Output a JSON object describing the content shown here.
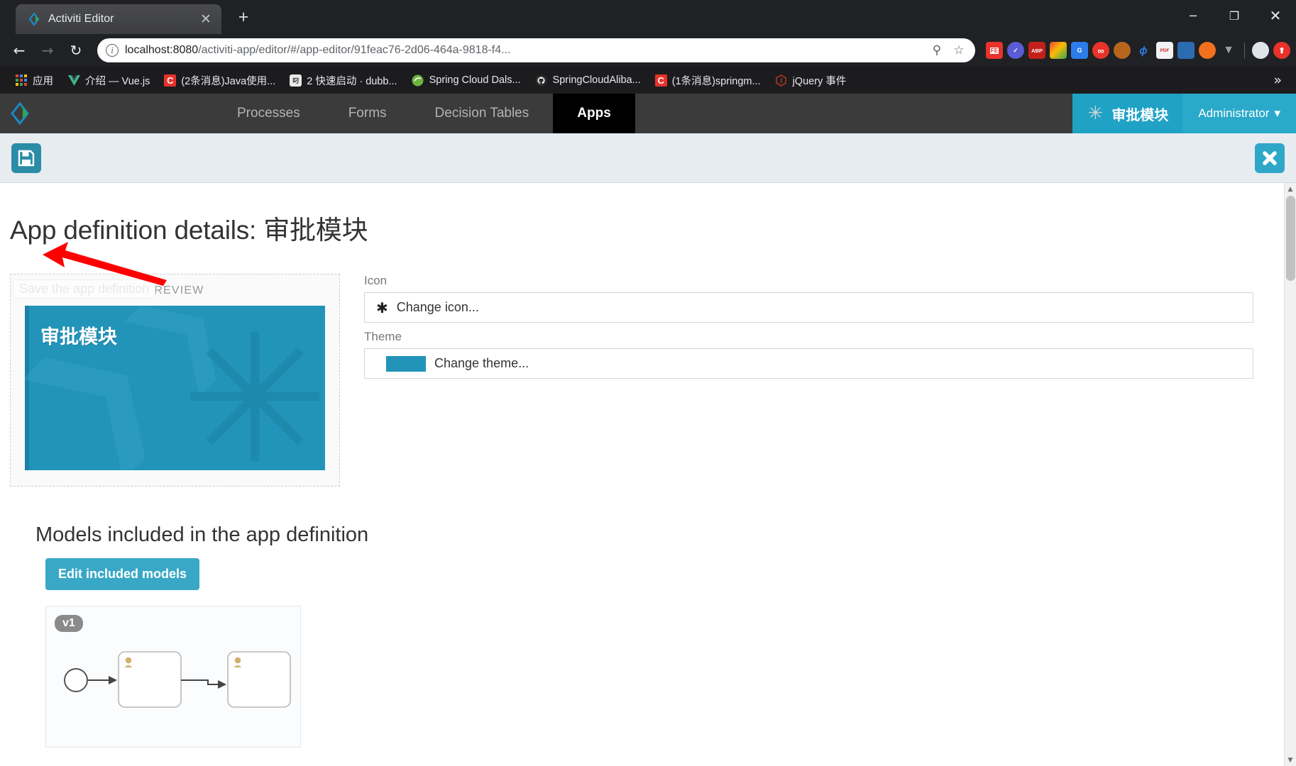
{
  "browser": {
    "tab": {
      "title": "Activiti Editor",
      "close_label": "✕",
      "favicon": "activiti-diamond-icon"
    },
    "new_tab_label": "+",
    "window_controls": {
      "minimize": "─",
      "maximize": "❐",
      "close": "✕"
    },
    "nav": {
      "back": "←",
      "forward": "→",
      "reload": "↻"
    },
    "omnibox": {
      "info_icon": "i",
      "url_host": "localhost:8080",
      "url_path": "/activiti-app/editor/#/app-editor/91feac76-2d06-464a-9818-f4...",
      "zoom_icon": "⚲",
      "bookmark_icon": "☆"
    },
    "extensions": [
      {
        "name": "fe-extension",
        "label": "FE",
        "color": "#e8322a"
      },
      {
        "name": "check-circle-extension",
        "label": "✓",
        "color": "#5b5bd6"
      },
      {
        "name": "adblock-plus-extension",
        "label": "ABP",
        "color": "#c3201b"
      },
      {
        "name": "google-app-extension",
        "label": "",
        "color": "#f9bc15"
      },
      {
        "name": "google-translate-extension",
        "label": "G",
        "color": "#2b7de9"
      },
      {
        "name": "infinity-extension",
        "label": "∞",
        "color": "#e8322a"
      },
      {
        "name": "monkey-extension",
        "label": "",
        "color": "#b8651c"
      },
      {
        "name": "leaf-extension",
        "label": "ф",
        "color": "#1a5fb4"
      },
      {
        "name": "pdfjs-extension",
        "label": "PDF",
        "color": "#d12c2c"
      },
      {
        "name": "block-extension",
        "label": "",
        "color": "#2b6cb0"
      },
      {
        "name": "orange-dot-extension",
        "label": "",
        "color": "#f2711c"
      },
      {
        "name": "v-extension",
        "label": "V",
        "color": "#8a8a8a"
      },
      {
        "name": "weather-extension",
        "label": "",
        "color": "#dfe4ea"
      },
      {
        "name": "upload-extension",
        "label": "⬆",
        "color": "#e8322a"
      }
    ],
    "bookmarks": [
      {
        "name": "apps",
        "label": "应用",
        "icon": "apps-grid-icon",
        "color": "#4285f4"
      },
      {
        "name": "vuejs",
        "label": "介绍 — Vue.js",
        "icon": "vue-icon",
        "color": "#41b883"
      },
      {
        "name": "csdn-java",
        "label": "(2条消息)Java使用...",
        "icon": "csdn-icon",
        "color": "#e8322a"
      },
      {
        "name": "dubbo-quickstart",
        "label": "2 快速启动 · dubb...",
        "icon": "dubbo-icon",
        "color": "#d8d8d8"
      },
      {
        "name": "spring-cloud-dalston",
        "label": "Spring Cloud Dals...",
        "icon": "spring-icon",
        "color": "#6db33f"
      },
      {
        "name": "spring-cloud-alibaba",
        "label": "SpringCloudAliba...",
        "icon": "github-icon",
        "color": "#24292e"
      },
      {
        "name": "csdn-springm",
        "label": "(1条消息)springm...",
        "icon": "csdn-icon",
        "color": "#e8322a"
      },
      {
        "name": "jquery-events",
        "label": "jQuery 事件",
        "icon": "jquery-icon",
        "color": "#c0392b"
      }
    ],
    "bookmarks_overflow": "»"
  },
  "app": {
    "logo": "activiti-logo-icon",
    "nav_items": [
      {
        "name": "processes",
        "label": "Processes",
        "active": false
      },
      {
        "name": "forms",
        "label": "Forms",
        "active": false
      },
      {
        "name": "decision-tables",
        "label": "Decision Tables",
        "active": false
      },
      {
        "name": "apps",
        "label": "Apps",
        "active": true
      }
    ],
    "current_app": {
      "label": "审批模块",
      "icon": "asterisk-icon"
    },
    "user_menu": {
      "label": "Administrator",
      "caret": "▾"
    },
    "toolbar": {
      "save_icon": "floppy-disk-save-icon",
      "save_tooltip": "Save the app definition",
      "close_icon": "close-x-icon"
    },
    "main": {
      "page_title": "App definition details: 审批模块",
      "preview": {
        "caption": "PREVIEW",
        "tile_name": "审批模块",
        "tile_color": "#2294b9",
        "tile_icon": "asterisk-icon"
      },
      "icon_field": {
        "label": "Icon",
        "value": "Change icon...",
        "glyph": "✱"
      },
      "theme_field": {
        "label": "Theme",
        "value": "Change theme...",
        "swatch_color": "#2294b9"
      },
      "models_section": {
        "title": "Models included in the app definition",
        "edit_button": "Edit included models",
        "model_card": {
          "version_badge": "v1",
          "diagram": "bpmn-process-thumbnail"
        }
      }
    },
    "scrollbar": {
      "up": "▲",
      "down": "▼"
    }
  },
  "annotation": {
    "arrow": "red-arrow-pointing-to-save-button"
  },
  "colors": {
    "accent": "#2294b9",
    "nav_app_bg": "#20a2c4",
    "nav_user_bg": "#2aa9ca",
    "subbar_bg": "#e7ecf0",
    "save_btn": "#2a8ca6",
    "close_btn": "#2fa7c9",
    "arrow_red": "#ff0000"
  }
}
